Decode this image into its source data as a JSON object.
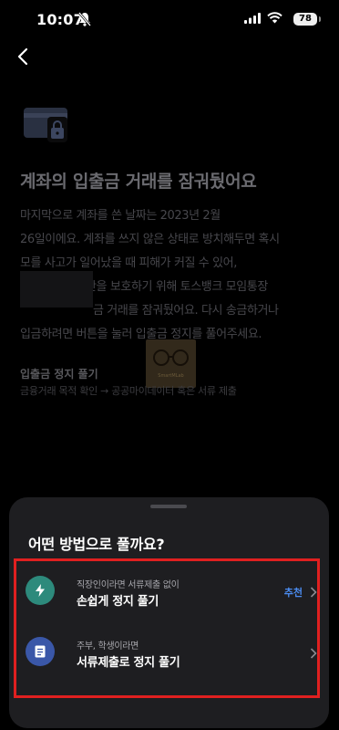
{
  "status": {
    "time": "10:07",
    "battery": "78"
  },
  "title": "계좌의 입출금 거래를 잠궈뒀어요",
  "body_lines": [
    "마지막으로 계좌를 쓴 날짜는 2023년 2월",
    "26일이에요. 계좌를 쓰지 않은 상태로 방치해두면 혹시",
    "모를 사고가 일어났을 때 피해가 커질 수 있어,",
    "산을 보호하기 위해 토스뱅크 모임통장",
    "금 거래를 잠궈뒀어요. 다시 송금하거나",
    "입금하려면 버튼을 눌러 입출금 정지를 풀어주세요."
  ],
  "watermark": "SmartMLab",
  "section": {
    "title": "입출금 정지 풀기",
    "subtitle": "금융거래 목적 확인 → 공공마이데이터 혹은 서류 제출"
  },
  "sheet": {
    "title": "어떤 방법으로 풀까요?",
    "options": [
      {
        "sub": "직장인이라면 서류제출 없이",
        "main": "손쉽게 정지 풀기",
        "badge": "추천",
        "icon": "lightning-icon"
      },
      {
        "sub": "주부, 학생이라면",
        "main": "서류제출로 정지 풀기",
        "icon": "document-icon"
      }
    ]
  },
  "colors": {
    "highlight": "#e02020",
    "accent": "#4b8cf0"
  }
}
